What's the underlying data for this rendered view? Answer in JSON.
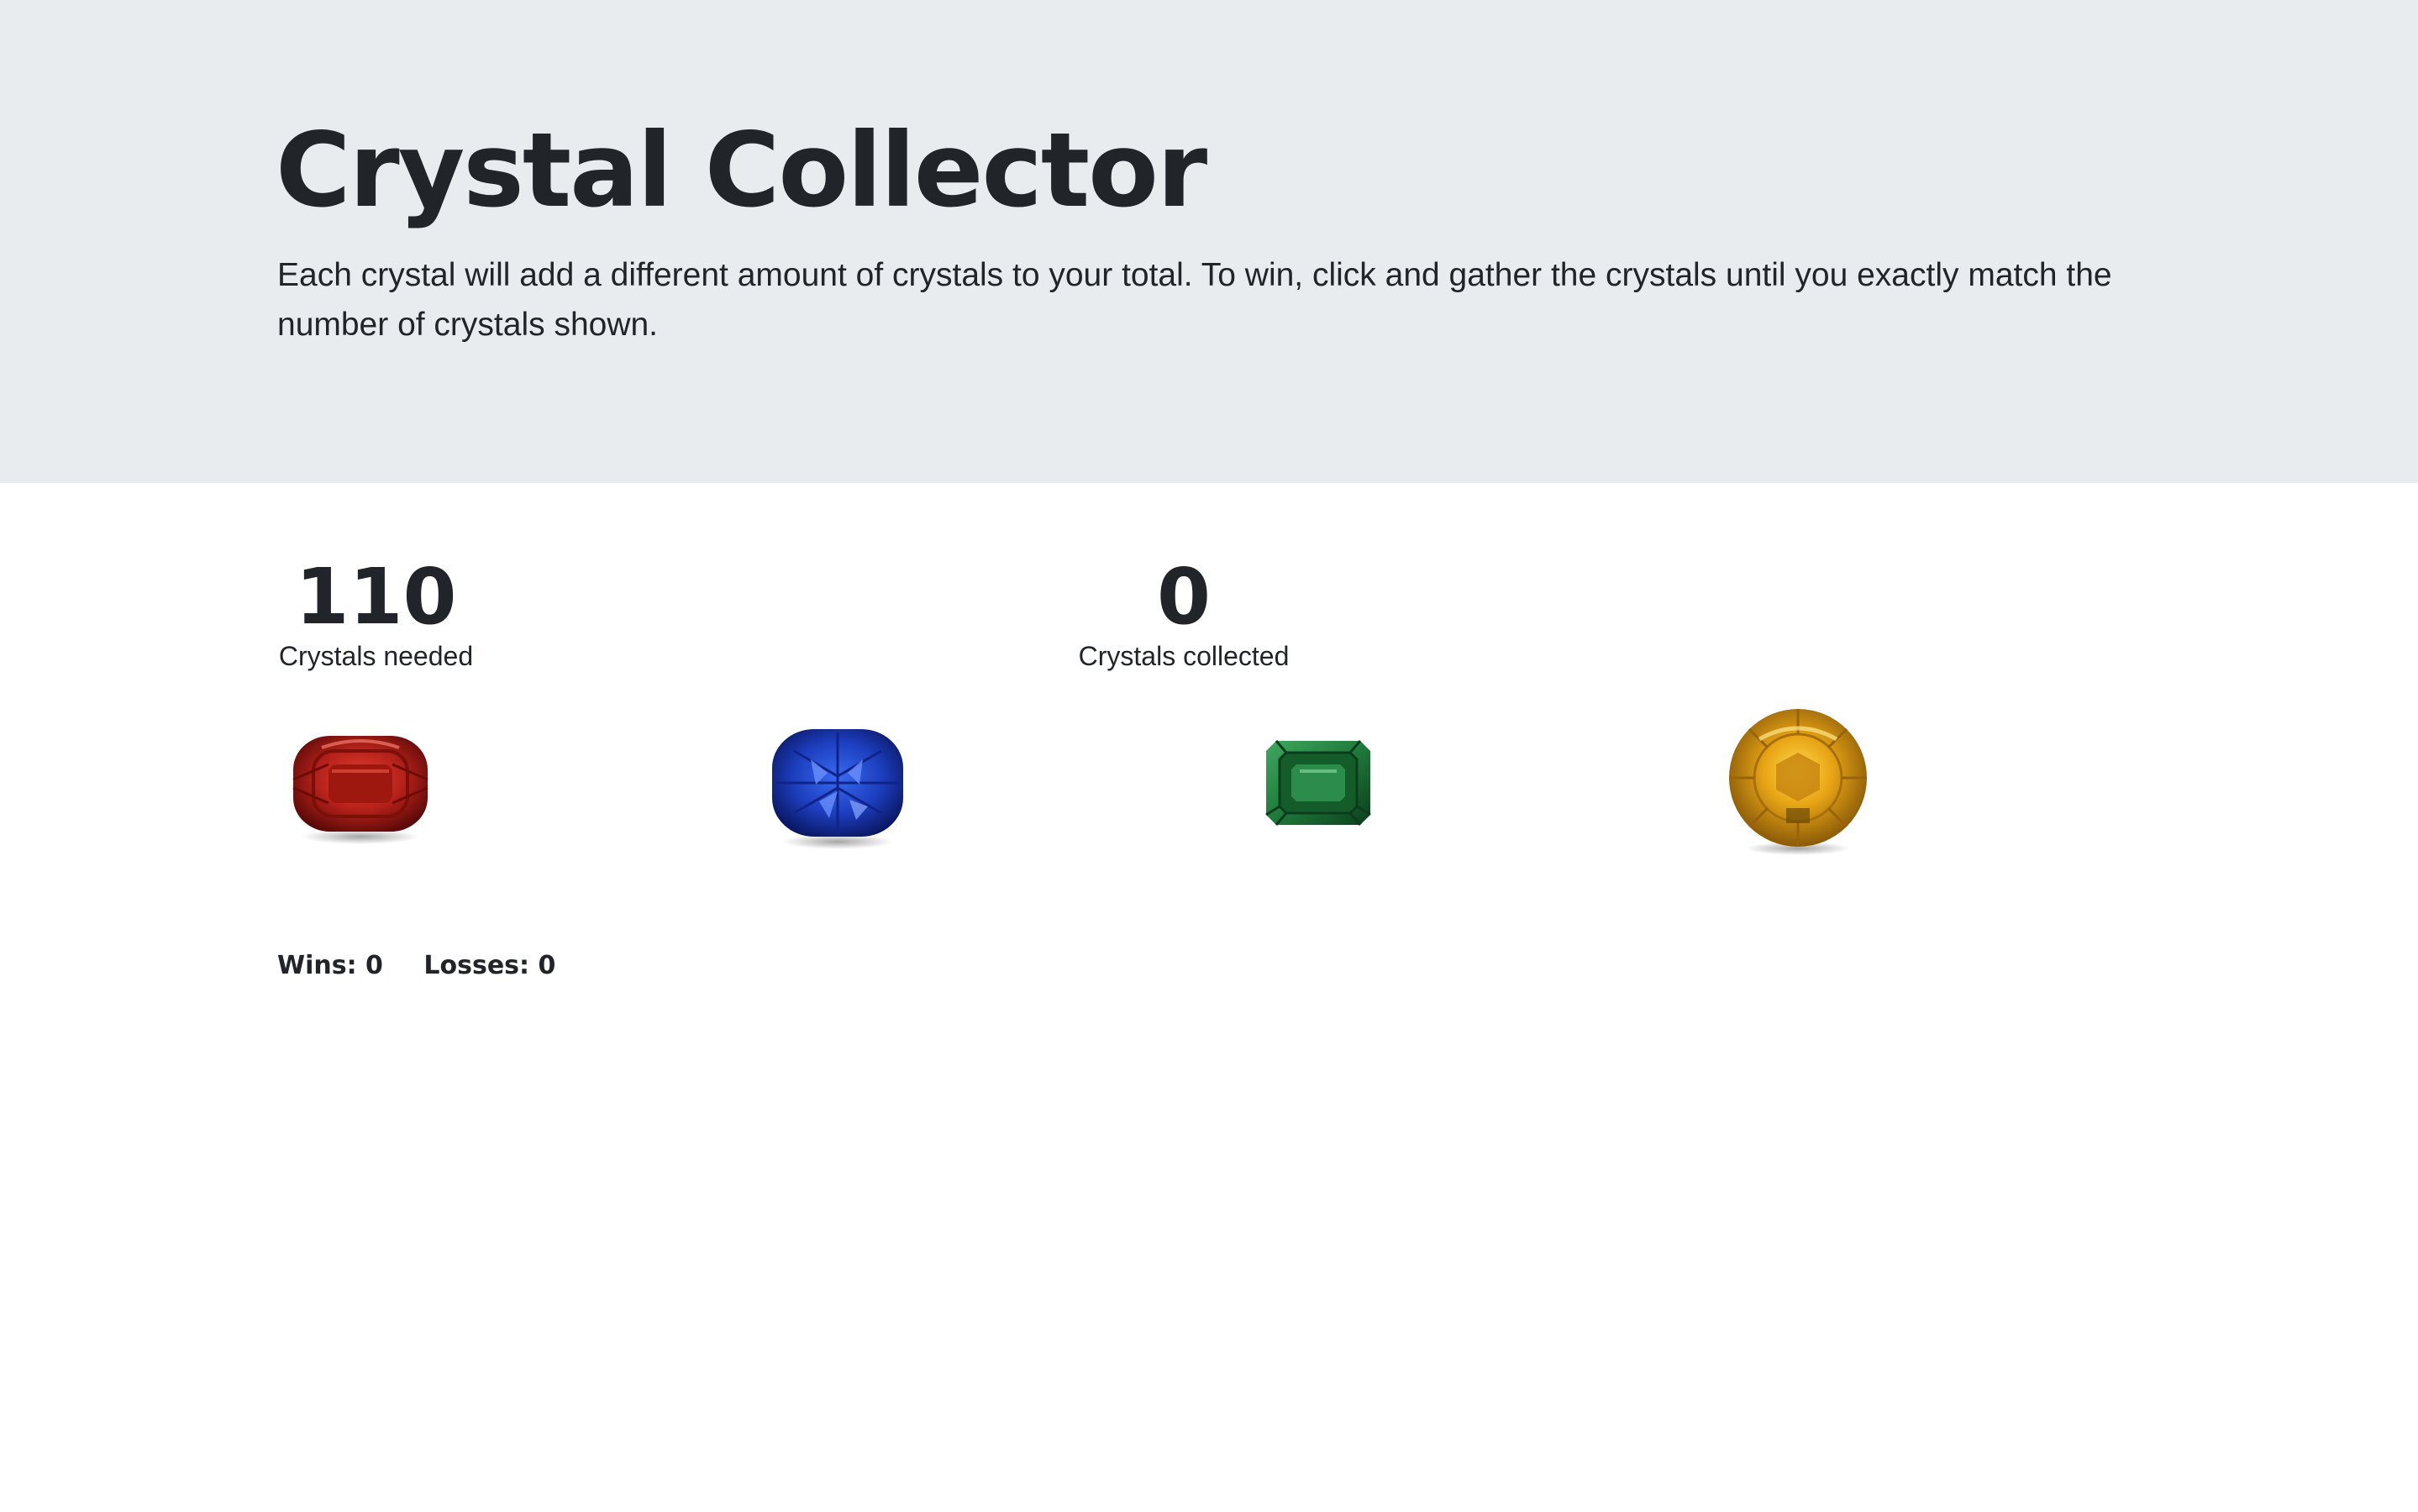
{
  "header": {
    "title": "Crystal Collector",
    "description": "Each crystal will add a different amount of crystals to your total. To win, click and gather the crystals until you exactly match the number of crystals shown."
  },
  "stats": {
    "needed": {
      "value": "110",
      "label": "Crystals needed"
    },
    "collected": {
      "value": "0",
      "label": "Crystals collected"
    }
  },
  "crystals": [
    {
      "name": "red-crystal",
      "color": "#b3201a"
    },
    {
      "name": "blue-crystal",
      "color": "#1d3fc0"
    },
    {
      "name": "green-crystal",
      "color": "#1f7a3a"
    },
    {
      "name": "yellow-crystal",
      "color": "#e8a516"
    }
  ],
  "score": {
    "wins_label": "Wins:",
    "wins": "0",
    "losses_label": "Losses:",
    "losses": "0"
  },
  "colors": {
    "jumbotron_bg": "#e9ecef",
    "text": "#212529",
    "page_bg": "#ffffff"
  }
}
